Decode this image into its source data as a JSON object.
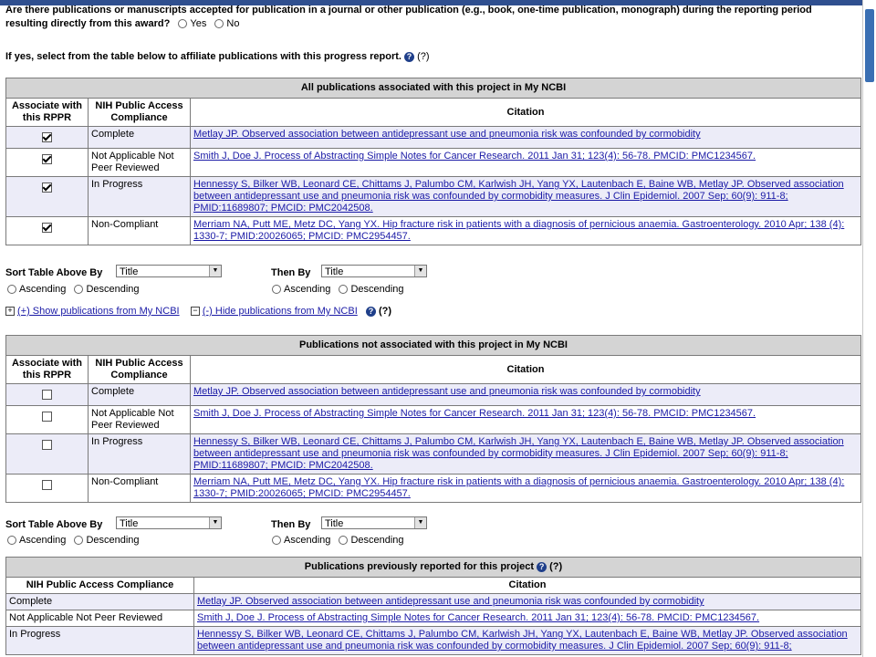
{
  "question": {
    "line1": "Are there publications or manuscripts accepted for publication in a journal or other publication (e.g., book, one-time publication, monograph) during the reporting period",
    "line2": "resulting directly from this award?",
    "yes": "Yes",
    "no": "No"
  },
  "instruction": {
    "text": "If yes, select from the table below to affiliate publications with this progress report.",
    "help": "(?)"
  },
  "table1": {
    "caption": "All publications associated with this project in My NCBI",
    "headers": [
      "Associate with this RPPR",
      "NIH Public Access Compliance",
      "Citation"
    ],
    "rows": [
      {
        "checked": true,
        "compliance": "Complete",
        "citation": "Metlay JP. Observed association between antidepressant use and pneumonia risk was confounded by cormobidity"
      },
      {
        "checked": true,
        "compliance": "Not Applicable Not Peer Reviewed",
        "citation": "Smith J, Doe J. Process of Abstracting Simple Notes for Cancer Research. 2011 Jan 31; 123(4): 56-78. PMCID: PMC1234567."
      },
      {
        "checked": true,
        "compliance": "In Progress",
        "citation": "Hennessy S, Bilker WB, Leonard CE, Chittams J, Palumbo CM, Karlwish JH, Yang YX, Lautenbach E, Baine WB, Metlay JP. Observed association between antidepressant use and pneumonia risk was confounded by cormobidity measures. J Clin Epidemiol. 2007 Sep; 60(9): 911-8; PMID:11689807; PMCID: PMC2042508."
      },
      {
        "checked": true,
        "compliance": "Non-Compliant",
        "citation": "Merriam NA, Putt ME, Metz DC, Yang YX. Hip fracture risk in patients with a diagnosis of pernicious anaemia. Gastroenterology. 2010 Apr; 138 (4): 1330-7; PMID:20026065; PMCID: PMC2954457."
      }
    ]
  },
  "sort1": {
    "label": "Sort Table Above By",
    "value": "Title",
    "then_label": "Then By",
    "then_value": "Title",
    "asc": "Ascending",
    "desc": "Descending"
  },
  "showhide": {
    "show": "(+) Show publications from My NCBI",
    "hide": "(-) Hide publications from My NCBI",
    "help": "(?)"
  },
  "table2": {
    "caption": "Publications not associated with this project in My NCBI",
    "headers": [
      "Associate with this RPPR",
      "NIH Public Access Compliance",
      "Citation"
    ],
    "rows": [
      {
        "checked": false,
        "compliance": "Complete",
        "citation": "Metlay JP. Observed association between antidepressant use and pneumonia risk was confounded by cormobidity"
      },
      {
        "checked": false,
        "compliance": "Not Applicable Not Peer Reviewed",
        "citation": "Smith J, Doe J. Process of Abstracting Simple Notes for Cancer Research. 2011 Jan 31; 123(4): 56-78. PMCID: PMC1234567."
      },
      {
        "checked": false,
        "compliance": "In Progress",
        "citation": "Hennessy S, Bilker WB, Leonard CE, Chittams J, Palumbo CM, Karlwish JH, Yang YX, Lautenbach E, Baine WB, Metlay JP. Observed association between antidepressant use and pneumonia risk was confounded by cormobidity measures. J Clin Epidemiol. 2007 Sep; 60(9): 911-8; PMID:11689807; PMCID: PMC2042508."
      },
      {
        "checked": false,
        "compliance": "Non-Compliant",
        "citation": "Merriam NA, Putt ME, Metz DC, Yang YX. Hip fracture risk in patients with a diagnosis of pernicious anaemia. Gastroenterology. 2010 Apr; 138 (4): 1330-7; PMID:20026065; PMCID: PMC2954457."
      }
    ]
  },
  "sort2": {
    "label": "Sort Table Above By",
    "value": "Title",
    "then_label": "Then By",
    "then_value": "Title",
    "asc": "Ascending",
    "desc": "Descending"
  },
  "table3": {
    "caption": "Publications previously reported for this project",
    "help": "(?)",
    "headers": [
      "NIH Public Access Compliance",
      "Citation"
    ],
    "rows": [
      {
        "compliance": "Complete",
        "citation": "Metlay JP. Observed association between antidepressant use and pneumonia risk was confounded by cormobidity"
      },
      {
        "compliance": "Not Applicable Not Peer Reviewed",
        "citation": "Smith J, Doe J. Process of Abstracting Simple Notes for Cancer Research. 2011 Jan 31; 123(4): 56-78. PMCID: PMC1234567."
      },
      {
        "compliance": "In Progress",
        "citation": "Hennessy S, Bilker WB, Leonard CE, Chittams J, Palumbo CM, Karlwish JH, Yang YX, Lautenbach E, Baine WB, Metlay JP. Observed association between antidepressant use and pneumonia risk was confounded by cormobidity measures. J Clin Epidemiol. 2007 Sep; 60(9): 911-8;"
      }
    ]
  }
}
